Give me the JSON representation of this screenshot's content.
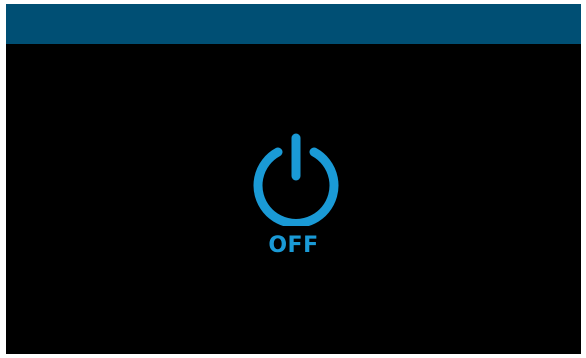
{
  "power": {
    "state_label": "OFF",
    "icon": "power-icon",
    "accent_color": "#1a9ad6"
  },
  "header": {
    "color": "#004f74"
  }
}
